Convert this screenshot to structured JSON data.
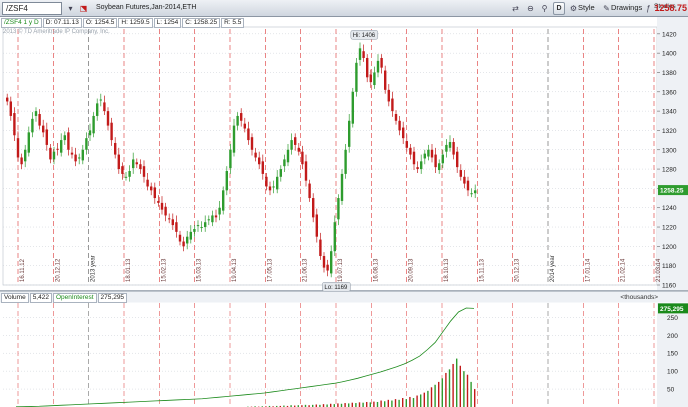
{
  "toolbar": {
    "symbol": "/ZSF4",
    "description": "Soybean Futures,Jan-2014,ETH",
    "style_label": "Style",
    "drawings_label": "Drawings",
    "studies_label": "Studies",
    "last_price": "1258.75",
    "d_button": "D"
  },
  "info": {
    "period": "/ZSF4 1 y D",
    "open": "D: 07.11.13",
    "o": "O: 1254.5",
    "h": "H: 1259.5",
    "l": "L: 1254",
    "c": "C: 1258.25",
    "r": "R: 5.5",
    "copyright": "2013 © TD Ameritrade IP Company, Inc."
  },
  "volume": {
    "label": "Volume",
    "value": "5,422",
    "oi_label": "OpenInterest",
    "oi_value": "275,295",
    "units": "<thousands>",
    "oi_marker": "275,295"
  },
  "price_marker": "1258.25",
  "high_label": "Hi: 1406",
  "low_label": "Lo: 1169",
  "colors": {
    "up": "#2e9c2e",
    "down": "#c21a1a",
    "grid": "#d33",
    "oi": "#1b8a1b",
    "bg": "#ffffff"
  },
  "chart_data": {
    "type": "line",
    "price_ticks": [
      "1420",
      "1400",
      "1380",
      "1360",
      "1340",
      "1320",
      "1300",
      "1280",
      "1260",
      "1240",
      "1220",
      "1200",
      "1180",
      "1160"
    ],
    "volume_ticks": [
      "250",
      "200",
      "150",
      "100",
      "50"
    ],
    "date_labels": [
      "16.11.12",
      "20.12.12",
      "2013 year",
      "18.01.13",
      "15.02.13",
      "15.03.13",
      "19.04.13",
      "17.05.13",
      "21.06.13",
      "19.07.13",
      "16.08.13",
      "20.09.13",
      "18.10.13",
      "15.11.13",
      "20.12.13",
      "2014 year",
      "17.01.14",
      "21.02.14",
      "21.03.14"
    ],
    "ylim": [
      1160,
      1425
    ],
    "volume_ylim": [
      0,
      290
    ],
    "closes": [
      1350,
      1335,
      1315,
      1292,
      1285,
      1300,
      1318,
      1332,
      1340,
      1325,
      1318,
      1305,
      1290,
      1298,
      1300,
      1310,
      1315,
      1300,
      1295,
      1288,
      1292,
      1300,
      1312,
      1320,
      1335,
      1348,
      1352,
      1340,
      1325,
      1310,
      1295,
      1280,
      1275,
      1272,
      1278,
      1290,
      1285,
      1280,
      1272,
      1262,
      1258,
      1250,
      1245,
      1238,
      1232,
      1228,
      1222,
      1215,
      1205,
      1200,
      1210,
      1215,
      1218,
      1222,
      1220,
      1225,
      1228,
      1232,
      1230,
      1240,
      1258,
      1278,
      1300,
      1325,
      1335,
      1330,
      1322,
      1310,
      1300,
      1292,
      1285,
      1275,
      1262,
      1258,
      1262,
      1272,
      1280,
      1290,
      1300,
      1310,
      1305,
      1298,
      1285,
      1268,
      1250,
      1230,
      1210,
      1190,
      1178,
      1175,
      1195,
      1225,
      1250,
      1275,
      1300,
      1330,
      1360,
      1390,
      1405,
      1395,
      1375,
      1370,
      1380,
      1392,
      1385,
      1362,
      1350,
      1340,
      1330,
      1320,
      1312,
      1302,
      1295,
      1285,
      1280,
      1288,
      1296,
      1300,
      1292,
      1282,
      1286,
      1295,
      1305,
      1308,
      1295,
      1282,
      1272,
      1265,
      1258,
      1255,
      1258
    ],
    "open_interest": [
      0.5,
      1,
      1.5,
      2,
      3,
      4,
      5,
      6,
      7,
      8,
      9,
      10,
      11,
      12,
      13,
      14,
      15,
      16,
      17,
      18,
      19,
      20,
      21,
      22,
      23,
      25,
      27,
      29,
      31,
      33,
      35,
      37,
      39,
      42,
      45,
      48,
      51,
      54,
      57,
      60,
      63,
      66,
      70,
      75,
      80,
      86,
      92,
      98,
      105,
      112,
      120,
      130,
      142,
      160,
      180,
      210,
      240,
      265,
      276,
      275
    ],
    "volumes": [
      1,
      1,
      2,
      1,
      2,
      2,
      3,
      2,
      3,
      3,
      4,
      3,
      5,
      4,
      5,
      5,
      6,
      5,
      6,
      7,
      6,
      8,
      7,
      9,
      8,
      10,
      9,
      11,
      10,
      12,
      11,
      13,
      12,
      14,
      13,
      15,
      14,
      18,
      16,
      20,
      18,
      22,
      20,
      25,
      22,
      28,
      25,
      32,
      35,
      40,
      45,
      55,
      62,
      70,
      80,
      95,
      105,
      120,
      135,
      115,
      100,
      90,
      70,
      50
    ]
  }
}
